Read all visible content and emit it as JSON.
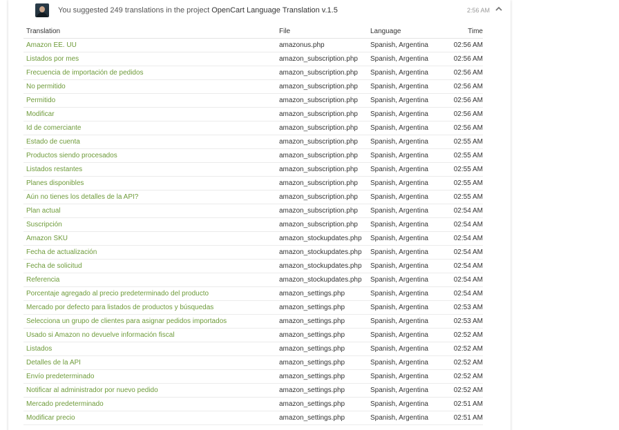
{
  "activity": {
    "type_icon": "translate-icon",
    "avatar_icon": "user-avatar",
    "message_prefix": "You suggested 249 translations in the project ",
    "project_name": "OpenCart Language Translation v.1.5",
    "time": "2:56 AM",
    "collapse_icon": "chevron-up-icon"
  },
  "table": {
    "headers": {
      "translation": "Translation",
      "file": "File",
      "language": "Language",
      "time": "Time"
    },
    "rows": [
      {
        "translation": "Amazon EE. UU",
        "file": "amazonus.php",
        "language": "Spanish, Argentina",
        "time": "02:56 AM"
      },
      {
        "translation": "Listados por mes",
        "file": "amazon_subscription.php",
        "language": "Spanish, Argentina",
        "time": "02:56 AM"
      },
      {
        "translation": "Frecuencia de importación de pedidos",
        "file": "amazon_subscription.php",
        "language": "Spanish, Argentina",
        "time": "02:56 AM"
      },
      {
        "translation": "No permitido",
        "file": "amazon_subscription.php",
        "language": "Spanish, Argentina",
        "time": "02:56 AM"
      },
      {
        "translation": "Permitido",
        "file": "amazon_subscription.php",
        "language": "Spanish, Argentina",
        "time": "02:56 AM"
      },
      {
        "translation": "Modificar",
        "file": "amazon_subscription.php",
        "language": "Spanish, Argentina",
        "time": "02:56 AM"
      },
      {
        "translation": "Id de comerciante",
        "file": "amazon_subscription.php",
        "language": "Spanish, Argentina",
        "time": "02:56 AM"
      },
      {
        "translation": "Estado de cuenta",
        "file": "amazon_subscription.php",
        "language": "Spanish, Argentina",
        "time": "02:55 AM"
      },
      {
        "translation": "Productos siendo procesados",
        "file": "amazon_subscription.php",
        "language": "Spanish, Argentina",
        "time": "02:55 AM"
      },
      {
        "translation": "Listados restantes",
        "file": "amazon_subscription.php",
        "language": "Spanish, Argentina",
        "time": "02:55 AM"
      },
      {
        "translation": "Planes disponibles",
        "file": "amazon_subscription.php",
        "language": "Spanish, Argentina",
        "time": "02:55 AM"
      },
      {
        "translation": "Aún no tienes los detalles de la API?",
        "file": "amazon_subscription.php",
        "language": "Spanish, Argentina",
        "time": "02:55 AM"
      },
      {
        "translation": "Plan actual",
        "file": "amazon_subscription.php",
        "language": "Spanish, Argentina",
        "time": "02:54 AM"
      },
      {
        "translation": "Suscripción",
        "file": "amazon_subscription.php",
        "language": "Spanish, Argentina",
        "time": "02:54 AM"
      },
      {
        "translation": "Amazon SKU",
        "file": "amazon_stockupdates.php",
        "language": "Spanish, Argentina",
        "time": "02:54 AM"
      },
      {
        "translation": "Fecha de actualización",
        "file": "amazon_stockupdates.php",
        "language": "Spanish, Argentina",
        "time": "02:54 AM"
      },
      {
        "translation": "Fecha de solicitud",
        "file": "amazon_stockupdates.php",
        "language": "Spanish, Argentina",
        "time": "02:54 AM"
      },
      {
        "translation": "Referencia",
        "file": "amazon_stockupdates.php",
        "language": "Spanish, Argentina",
        "time": "02:54 AM"
      },
      {
        "translation": "Porcentaje agregado al precio predeterminado del producto",
        "file": "amazon_settings.php",
        "language": "Spanish, Argentina",
        "time": "02:54 AM"
      },
      {
        "translation": "Mercado por defecto para listados de productos y búsquedas",
        "file": "amazon_settings.php",
        "language": "Spanish, Argentina",
        "time": "02:53 AM"
      },
      {
        "translation": "Selecciona un grupo de clientes para asignar pedidos importados",
        "file": "amazon_settings.php",
        "language": "Spanish, Argentina",
        "time": "02:53 AM"
      },
      {
        "translation": "Usado si Amazon no devuelve información fiscal",
        "file": "amazon_settings.php",
        "language": "Spanish, Argentina",
        "time": "02:52 AM"
      },
      {
        "translation": "Listados",
        "file": "amazon_settings.php",
        "language": "Spanish, Argentina",
        "time": "02:52 AM"
      },
      {
        "translation": "Detalles de la API",
        "file": "amazon_settings.php",
        "language": "Spanish, Argentina",
        "time": "02:52 AM"
      },
      {
        "translation": "Envío predeterminado",
        "file": "amazon_settings.php",
        "language": "Spanish, Argentina",
        "time": "02:52 AM"
      },
      {
        "translation": "Notificar al administrador por nuevo pedido",
        "file": "amazon_settings.php",
        "language": "Spanish, Argentina",
        "time": "02:52 AM"
      },
      {
        "translation": "Mercado predeterminado",
        "file": "amazon_settings.php",
        "language": "Spanish, Argentina",
        "time": "02:51 AM"
      },
      {
        "translation": "Modificar precio",
        "file": "amazon_settings.php",
        "language": "Spanish, Argentina",
        "time": "02:51 AM"
      }
    ]
  },
  "colors": {
    "link_green": "#6e9b3a",
    "text": "#333333",
    "muted": "#999999",
    "divider": "#ebebeb"
  }
}
